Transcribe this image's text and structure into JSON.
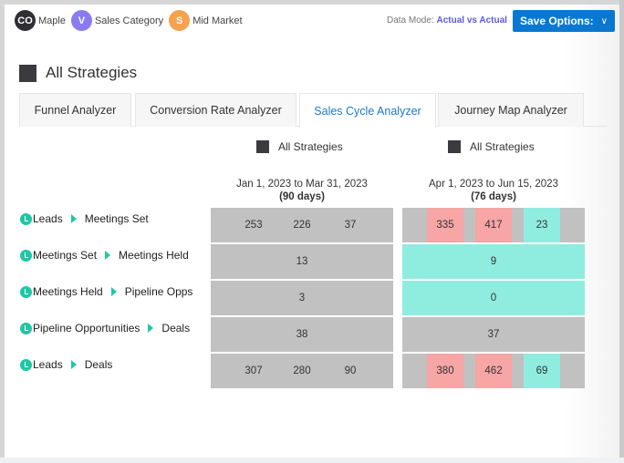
{
  "filters": [
    {
      "badge": "CO",
      "label": "Maple",
      "color": "#2f2f33"
    },
    {
      "badge": "V",
      "label": "Sales Category",
      "color": "#8a7cf0"
    },
    {
      "badge": "S",
      "label": "Mid Market",
      "color": "#f4a24e"
    }
  ],
  "data_mode": {
    "label": "Data Mode:",
    "value": "Actual vs Actual"
  },
  "save_button": {
    "label": "Save Options:",
    "icon": "chevron-down-icon"
  },
  "strategy": {
    "title": "All Strategies",
    "color": "#3a3a3f"
  },
  "tabs": [
    {
      "label": "Funnel Analyzer",
      "active": false
    },
    {
      "label": "Conversion Rate Analyzer",
      "active": false
    },
    {
      "label": "Sales Cycle Analyzer",
      "active": true
    },
    {
      "label": "Journey Map Analyzer",
      "active": false
    }
  ],
  "columns": [
    {
      "legend": "All Strategies",
      "date_range": "Jan 1, 2023 to Mar 31, 2023",
      "days": "(90 days)"
    },
    {
      "legend": "All Strategies",
      "date_range": "Apr 1, 2023 to Jun 15, 2023",
      "days": "(76 days)"
    }
  ],
  "colors": {
    "neutral": "#c1c1c1",
    "worse": "#f7a5a5",
    "better": "#8fede0",
    "accent": "#1ec7a5"
  },
  "rows": [
    {
      "from": "Leads",
      "to": "Meetings Set",
      "period1": [
        "253",
        "226",
        "37"
      ],
      "period2": [
        "335",
        "417",
        "23"
      ],
      "period2_status": [
        "worse",
        "worse",
        "better"
      ]
    },
    {
      "from": "Meetings Set",
      "to": "Meetings Held",
      "period1": [
        "13"
      ],
      "period2": [
        "9"
      ],
      "period2_status": [
        "better"
      ]
    },
    {
      "from": "Meetings Held",
      "to": "Pipeline Opps",
      "period1": [
        "3"
      ],
      "period2": [
        "0"
      ],
      "period2_status": [
        "better"
      ]
    },
    {
      "from": "Pipeline Opportunities",
      "to": "Deals",
      "period1": [
        "38"
      ],
      "period2": [
        "37"
      ],
      "period2_status": [
        "neutral"
      ]
    },
    {
      "from": "Leads",
      "to": "Deals",
      "period1": [
        "307",
        "280",
        "90"
      ],
      "period2": [
        "380",
        "462",
        "69"
      ],
      "period2_status": [
        "worse",
        "worse",
        "better"
      ]
    }
  ]
}
